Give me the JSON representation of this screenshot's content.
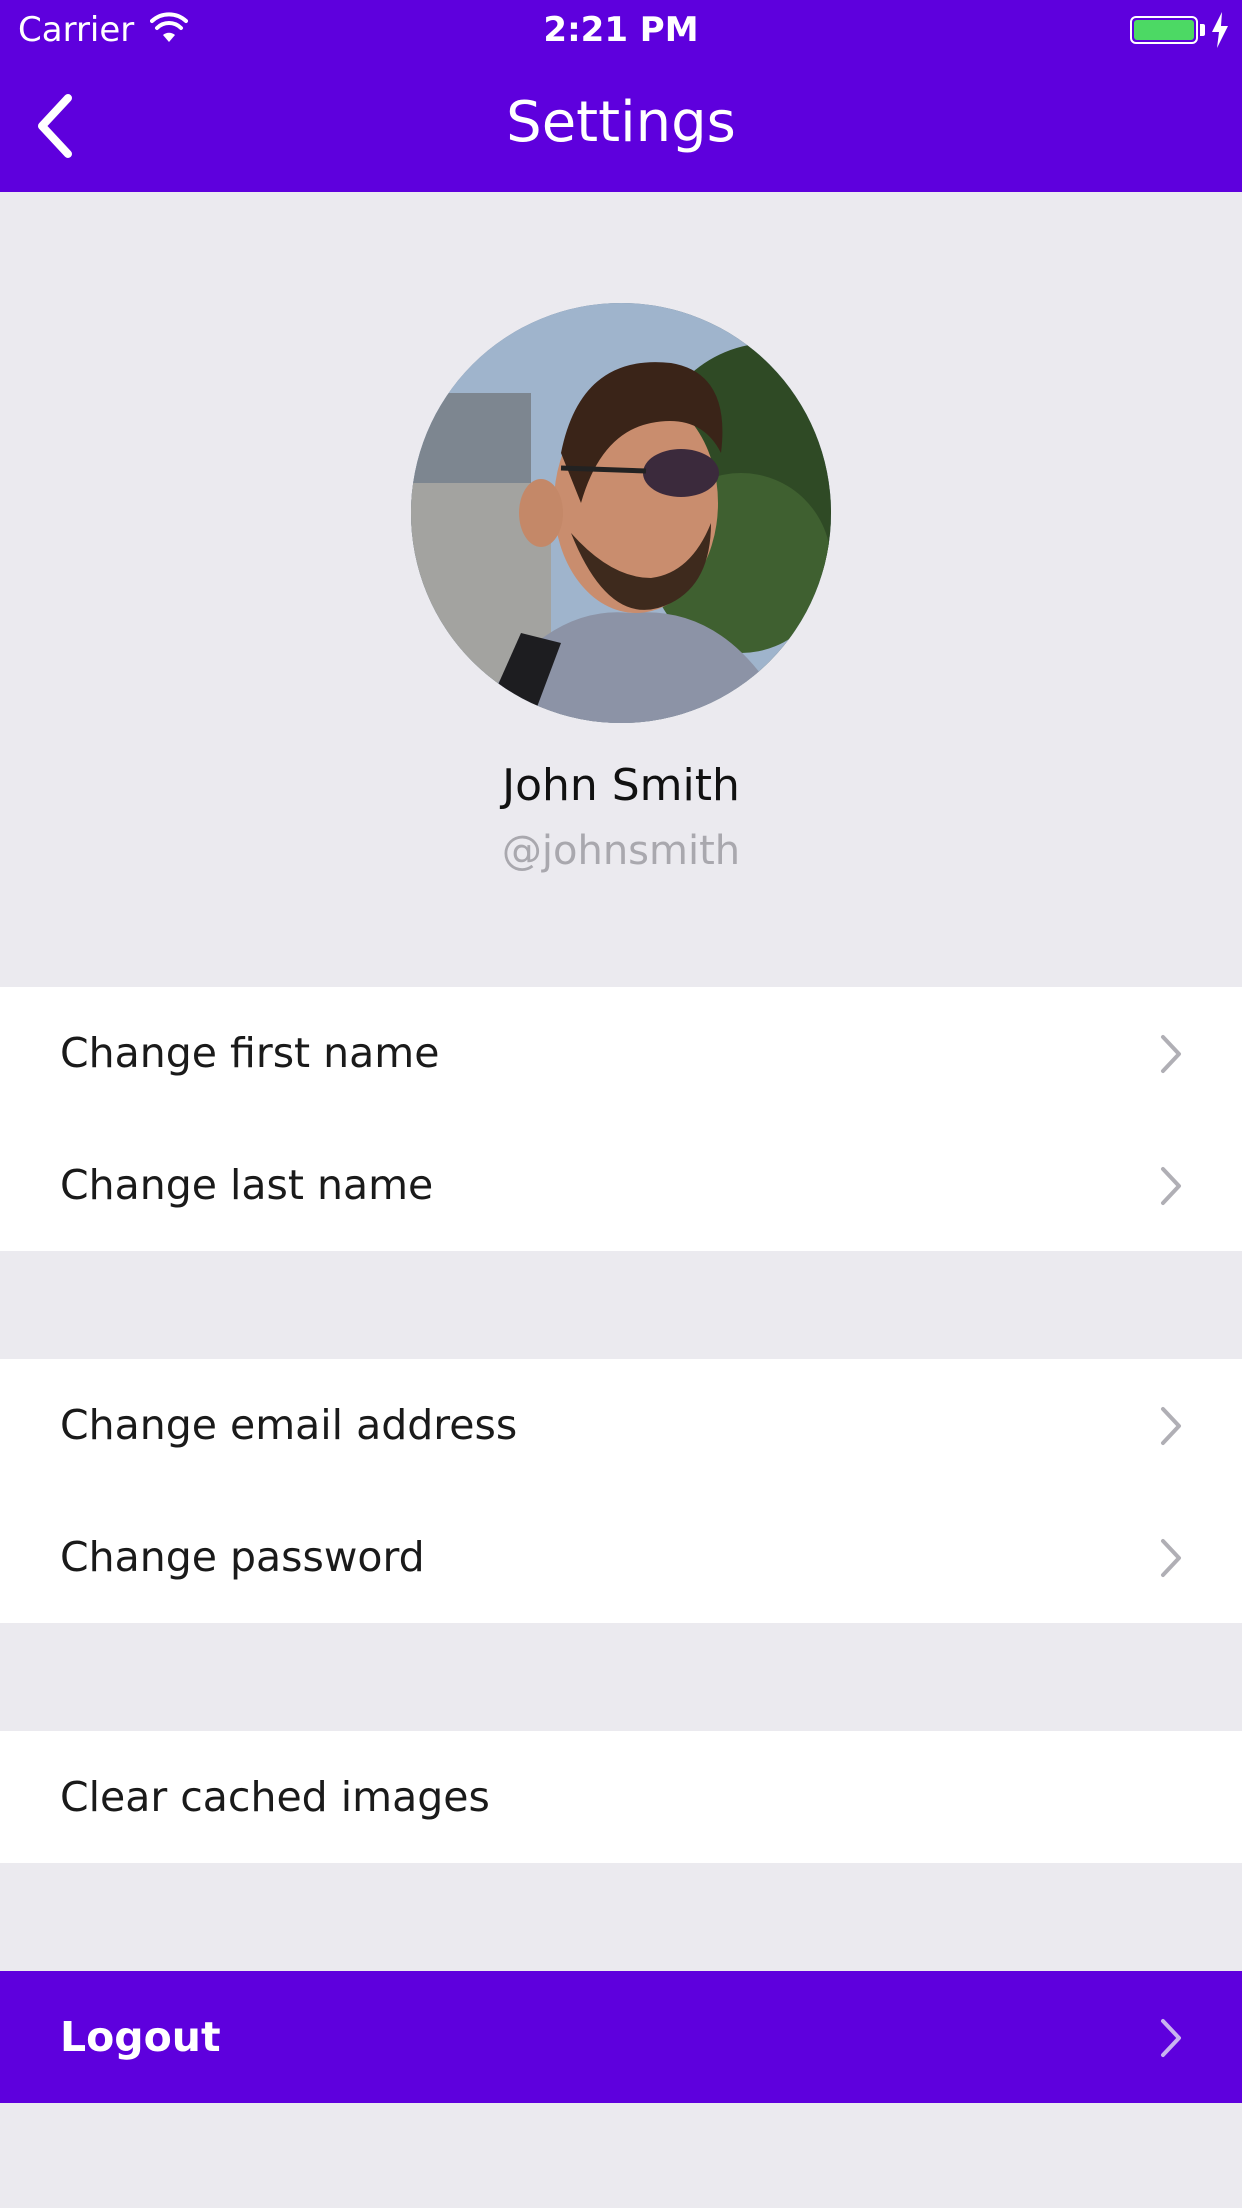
{
  "status_bar": {
    "carrier": "Carrier",
    "time": "2:21 PM",
    "wifi_icon": "wifi-icon",
    "battery_icon": "battery-icon",
    "charging_icon": "bolt-icon",
    "battery_level": 1.0
  },
  "nav": {
    "title": "Settings",
    "back_icon": "chevron-left-icon"
  },
  "profile": {
    "name": "John Smith",
    "handle": "@johnsmith"
  },
  "groups": [
    {
      "items": [
        {
          "label": "Change first name",
          "chevron": true
        },
        {
          "label": "Change last name",
          "chevron": true
        }
      ]
    },
    {
      "items": [
        {
          "label": "Change email address",
          "chevron": true
        },
        {
          "label": "Change password",
          "chevron": true
        }
      ]
    },
    {
      "items": [
        {
          "label": "Clear cached images",
          "chevron": false
        }
      ]
    }
  ],
  "logout": {
    "label": "Logout"
  },
  "colors": {
    "accent": "#5e00dd",
    "background": "#ebeaef",
    "row": "#ffffff",
    "chevron": "#b0afb5",
    "handle": "#a9a8ae",
    "battery": "#4cd964"
  }
}
